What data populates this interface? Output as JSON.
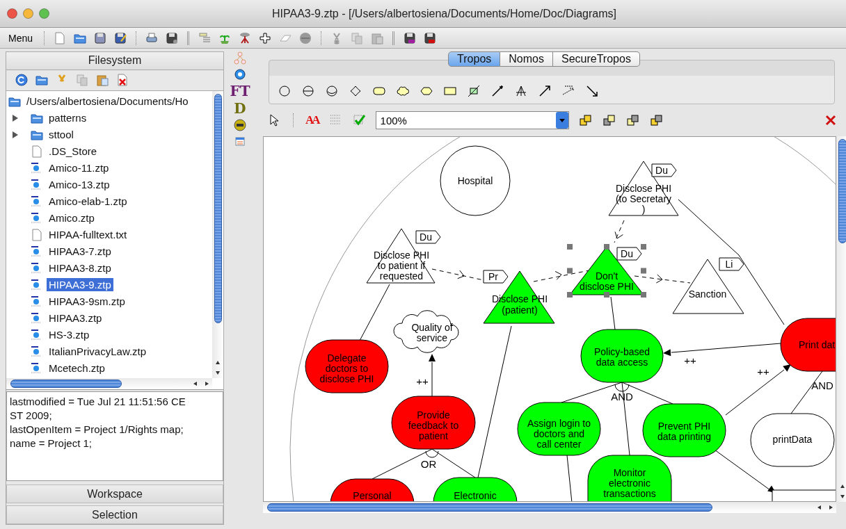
{
  "window": {
    "title": "HIPAA3-9.ztp - [/Users/albertosiena/Documents/Home/Doc/Diagrams]"
  },
  "toolbar": {
    "menu": "Menu"
  },
  "filesystem": {
    "title": "Filesystem",
    "root": "/Users/albertosiena/Documents/Ho",
    "items": [
      {
        "name": "patterns",
        "kind": "folder",
        "expanded": false,
        "selected": false
      },
      {
        "name": "sttool",
        "kind": "folder",
        "expanded": false,
        "selected": false
      },
      {
        "name": ".DS_Store",
        "kind": "file",
        "selected": false
      },
      {
        "name": "Amico-11.ztp",
        "kind": "model",
        "selected": false
      },
      {
        "name": "Amico-13.ztp",
        "kind": "model",
        "selected": false
      },
      {
        "name": "Amico-elab-1.ztp",
        "kind": "model",
        "selected": false
      },
      {
        "name": "Amico.ztp",
        "kind": "model",
        "selected": false
      },
      {
        "name": "HIPAA-fulltext.txt",
        "kind": "file",
        "selected": false
      },
      {
        "name": "HIPAA3-7.ztp",
        "kind": "model",
        "selected": false
      },
      {
        "name": "HIPAA3-8.ztp",
        "kind": "model",
        "selected": false
      },
      {
        "name": "HIPAA3-9.ztp",
        "kind": "model",
        "selected": true
      },
      {
        "name": "HIPAA3-9sm.ztp",
        "kind": "model",
        "selected": false
      },
      {
        "name": "HIPAA3.ztp",
        "kind": "model",
        "selected": false
      },
      {
        "name": "HS-3.ztp",
        "kind": "model",
        "selected": false
      },
      {
        "name": "ItalianPrivacyLaw.ztp",
        "kind": "model",
        "selected": false
      },
      {
        "name": "Mcetech.ztp",
        "kind": "model",
        "selected": false
      }
    ]
  },
  "properties": [
    "lastmodified = Tue Jul 21 11:51:56 CEST 2009;",
    "lastOpenItem = Project 1/Rights map;",
    "name = Project 1;"
  ],
  "sections": [
    "Workspace",
    "Selection"
  ],
  "side_tools": [
    "FT",
    "D"
  ],
  "palette": {
    "tabs": [
      {
        "label": "Tropos",
        "selected": true
      },
      {
        "label": "Nomos",
        "selected": false
      },
      {
        "label": "SecureTropos",
        "selected": false
      }
    ]
  },
  "view_toolbar": {
    "font_button": "AA",
    "zoom": "100%"
  },
  "diagram": {
    "nodes": [
      {
        "kind": "actor",
        "lines": [
          "Hospital"
        ],
        "selected": false
      },
      {
        "kind": "norm",
        "lines": [
          "Disclose PHI",
          "to patient if",
          "requested"
        ],
        "tag": "Du",
        "selected": false
      },
      {
        "kind": "norm",
        "lines": [
          "Disclose PHI",
          "(to Secretary",
          ")"
        ],
        "tag": "Du",
        "selected": false
      },
      {
        "kind": "norm",
        "lines": [
          "Disclose PHI",
          "(patient)"
        ],
        "tag": "Pr",
        "color": "#00ff00",
        "selected": false
      },
      {
        "kind": "norm",
        "lines": [
          "Don't",
          "disclose PHI"
        ],
        "tag": "Du",
        "color": "#00ff00",
        "selected": true
      },
      {
        "kind": "norm",
        "lines": [
          "Sanction"
        ],
        "tag": "Li",
        "selected": false
      },
      {
        "kind": "softgoal",
        "lines": [
          "Quality of",
          "service"
        ],
        "selected": false
      },
      {
        "kind": "goal",
        "lines": [
          "Delegate",
          "doctors to",
          "disclose PHI"
        ],
        "color": "#ff0000",
        "selected": false
      },
      {
        "kind": "goal",
        "lines": [
          "Provide",
          "feedback to",
          "patient"
        ],
        "color": "#ff0000",
        "selected": false
      },
      {
        "kind": "goal",
        "lines": [
          "Personal"
        ],
        "color": "#ff0000",
        "selected": false
      },
      {
        "kind": "goal",
        "lines": [
          "Electronic"
        ],
        "color": "#00ff00",
        "selected": false
      },
      {
        "kind": "goal",
        "lines": [
          "Policy-based",
          "data access"
        ],
        "color": "#00ff00",
        "selected": false
      },
      {
        "kind": "goal",
        "lines": [
          "Print dat"
        ],
        "color": "#ff0000",
        "selected": false
      },
      {
        "kind": "goal",
        "lines": [
          "Assign login to",
          "doctors and",
          "call center"
        ],
        "color": "#00ff00",
        "selected": false
      },
      {
        "kind": "goal",
        "lines": [
          "Monitor",
          "electronic",
          "transactions"
        ],
        "color": "#00ff00",
        "selected": false
      },
      {
        "kind": "goal",
        "lines": [
          "Prevent PHI",
          "data printing"
        ],
        "color": "#00ff00",
        "selected": false
      },
      {
        "kind": "goal",
        "lines": [
          "printData"
        ],
        "selected": false
      },
      {
        "kind": "box",
        "selected": false
      }
    ],
    "labels": [
      "++",
      "++",
      "++",
      "AND",
      "AND",
      "OR"
    ]
  }
}
